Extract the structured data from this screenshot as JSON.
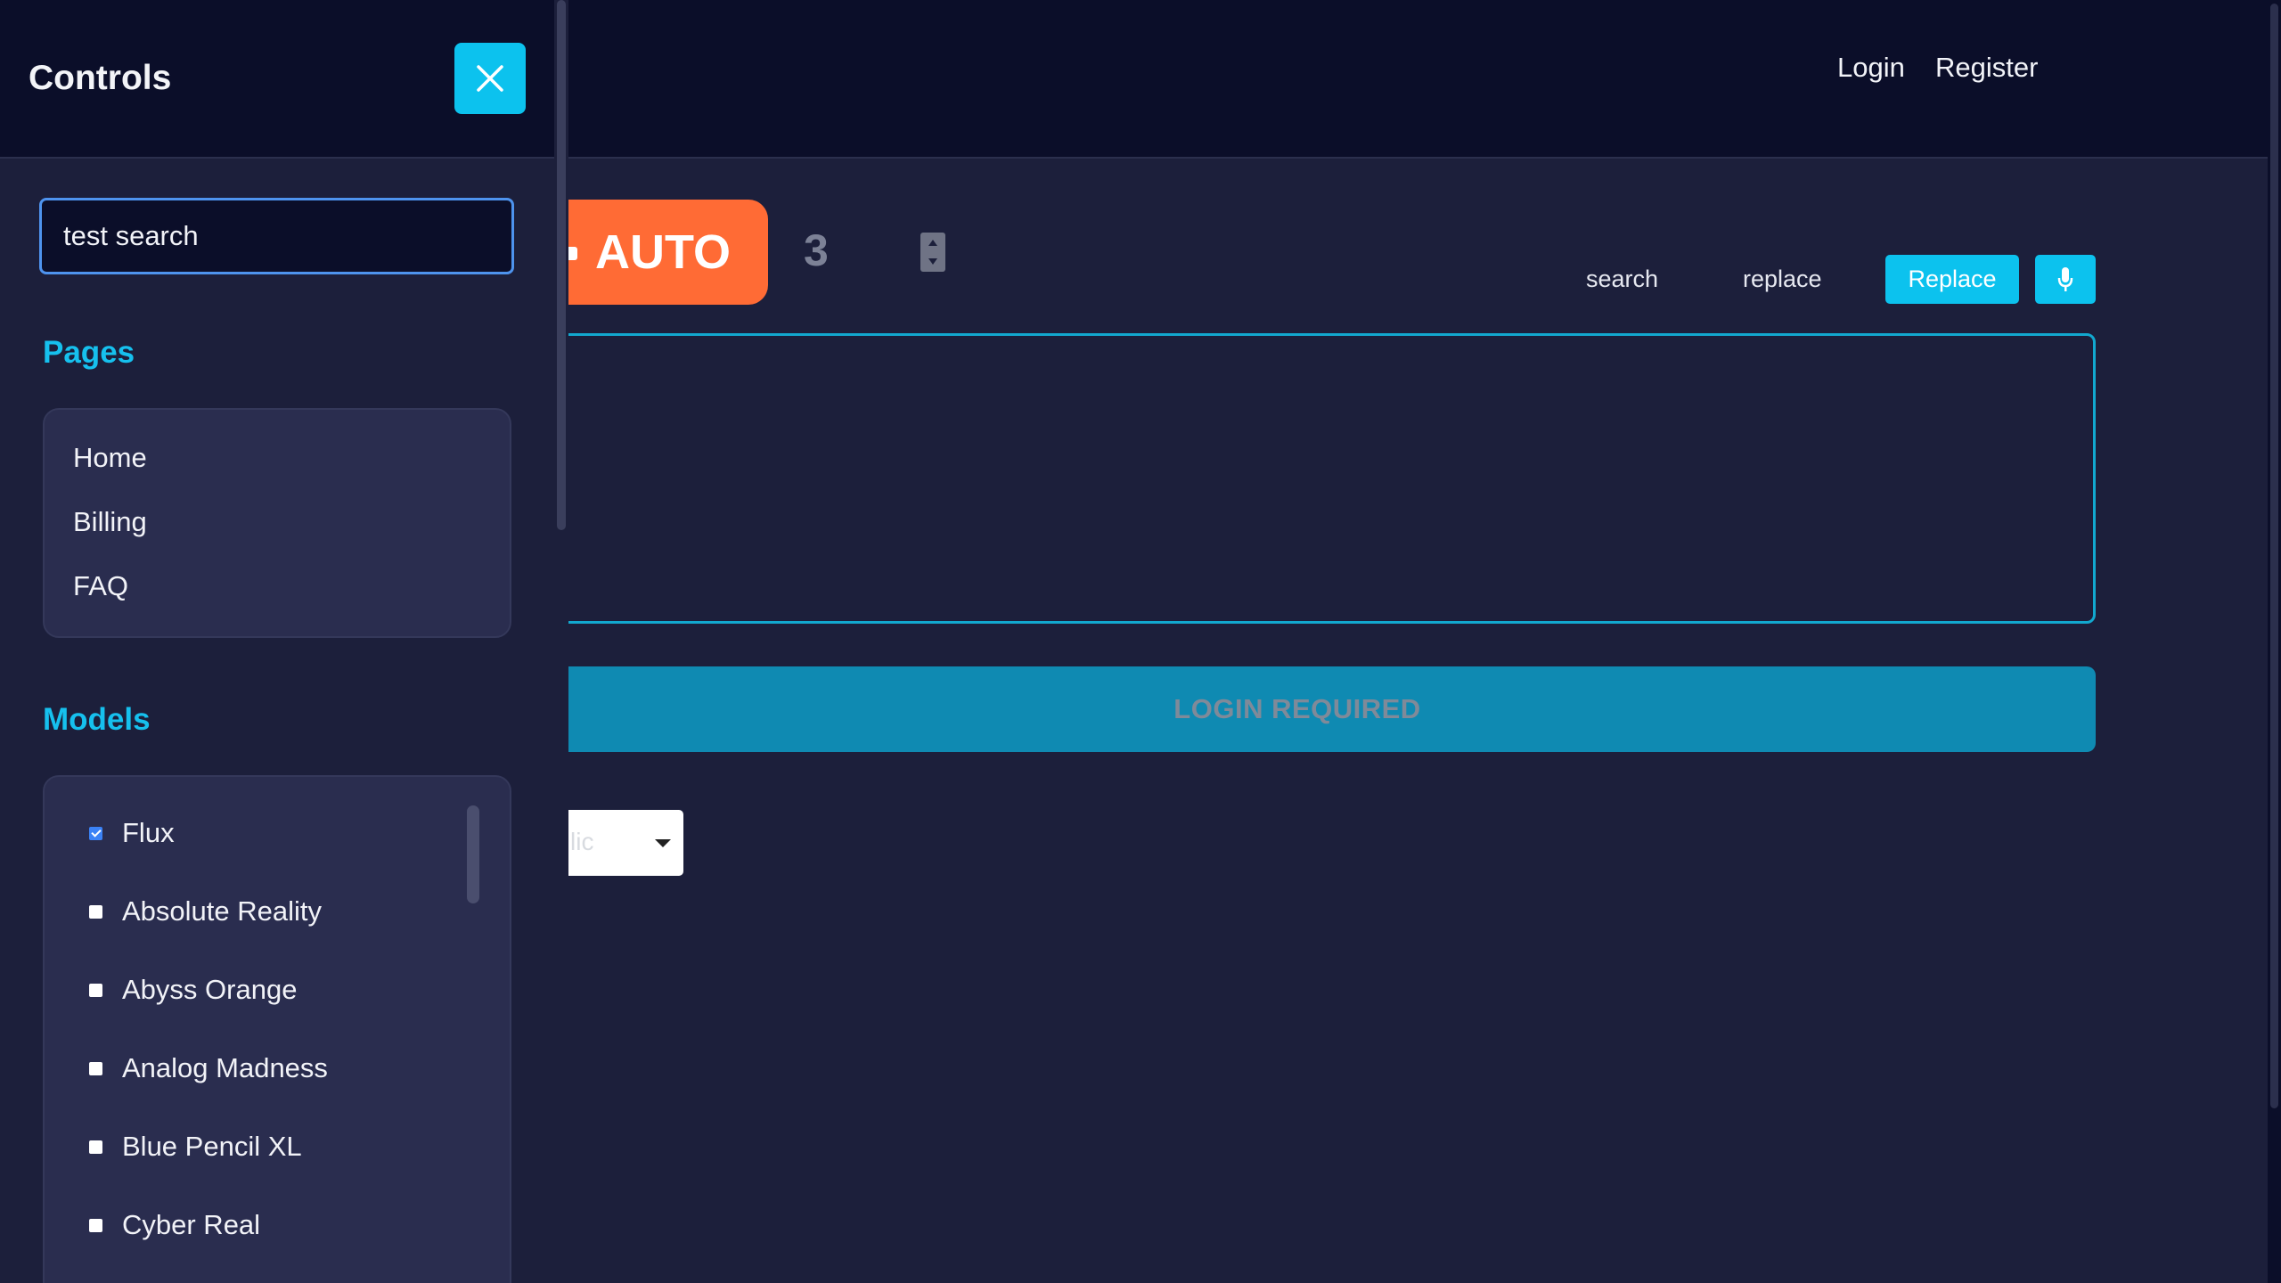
{
  "header": {
    "nav": [
      "Login",
      "Register"
    ]
  },
  "toolbar": {
    "auto_label": "AUTO",
    "count_value": "3",
    "search_label": "search",
    "replace_label": "replace",
    "replace_button": "Replace",
    "mic_icon": "microphone-icon"
  },
  "main": {
    "login_required": "LOGIN REQUIRED",
    "select_value": "lic"
  },
  "panel": {
    "title": "Controls",
    "close_icon": "close-icon",
    "search_value": "test search",
    "pages_title": "Pages",
    "pages": [
      "Home",
      "Billing",
      "FAQ"
    ],
    "models_title": "Models",
    "models": [
      {
        "label": "Flux",
        "checked": true
      },
      {
        "label": "Absolute Reality",
        "checked": false
      },
      {
        "label": "Abyss Orange",
        "checked": false
      },
      {
        "label": "Analog Madness",
        "checked": false
      },
      {
        "label": "Blue Pencil XL",
        "checked": false
      },
      {
        "label": "Cyber Real",
        "checked": false
      }
    ]
  },
  "colors": {
    "accent": "#0cc2ee",
    "auto_orange": "#ff6b35",
    "background": "#1c1f3b",
    "header": "#0b0e29"
  }
}
